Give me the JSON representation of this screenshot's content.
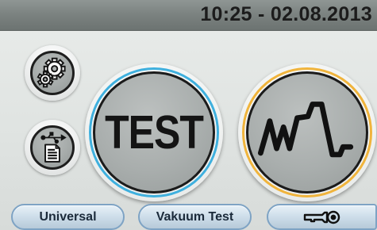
{
  "status_bar": {
    "datetime": "10:25 - 02.08.2013"
  },
  "side_buttons": [
    {
      "icon": "gears-icon"
    },
    {
      "icon": "usb-document-icon"
    }
  ],
  "main_buttons": {
    "test_label": "TEST",
    "test_ring_color": "#3fb0de",
    "curve_ring_color": "#f0b43c",
    "curve_icon": "pressure-curve-icon"
  },
  "bottom_bar": {
    "universal_label": "Universal",
    "vacuum_label": "Vakuum Test",
    "key_icon": "key-icon"
  },
  "colors": {
    "topbar": "#7c8381",
    "button_border": "#7ea3c4"
  }
}
